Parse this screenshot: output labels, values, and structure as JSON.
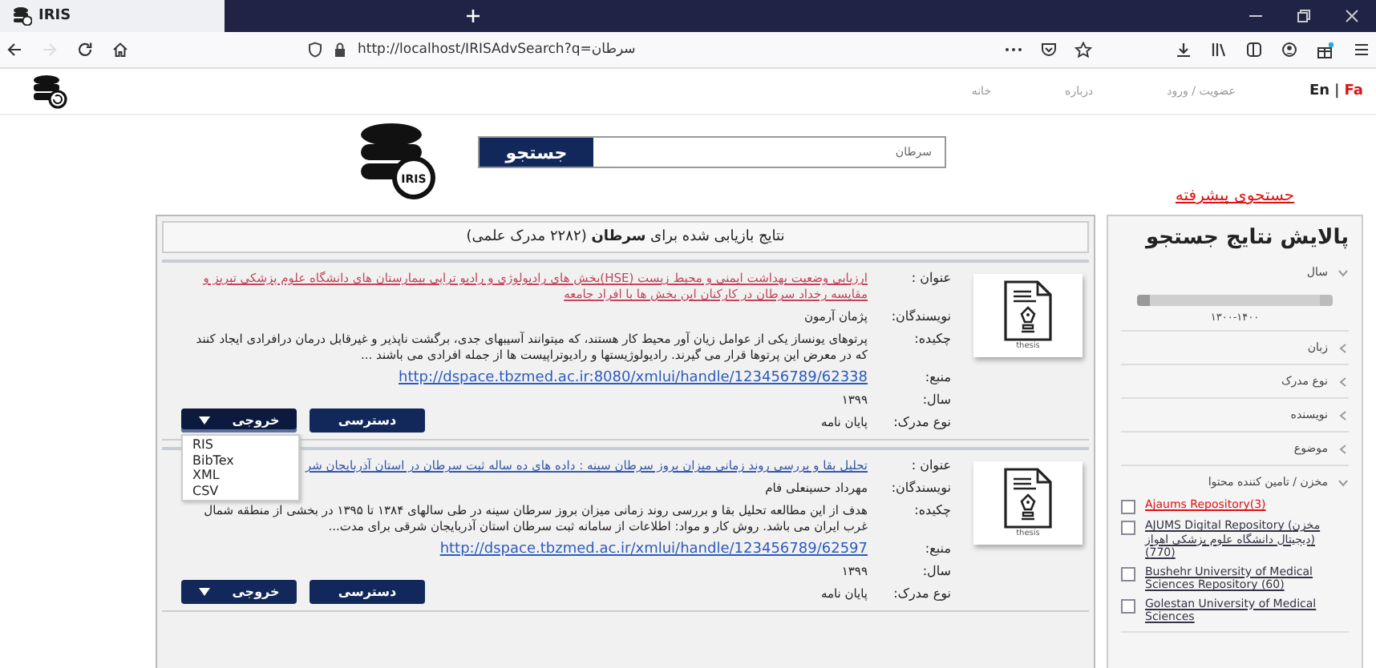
{
  "browser": {
    "tab_title": "IRIS",
    "url": "http://localhost/IRISAdvSearch?q=سرطان",
    "forward_disabled": true
  },
  "site_nav": {
    "languages": [
      {
        "label": "Fa",
        "selected": true
      },
      {
        "label": "En",
        "selected": false
      }
    ],
    "separator": "|",
    "links": [
      "عضویت / ورود",
      "درباره",
      "خانه"
    ]
  },
  "search": {
    "logo_text": "IRIS",
    "value": "سرطان",
    "button": "جستجو",
    "advanced_link": "جستجوی پیشرفته"
  },
  "results": {
    "heading": "نتایج بازیابی شده برای **سرطان** (۲۲۸۲ مدرک علمی)",
    "export_options": [
      "RIS",
      "BibTex",
      "XML",
      "CSV"
    ],
    "items": [
      {
        "thumbnail_caption": "thesis",
        "export_expanded": true,
        "buttons": [
          "دسترسی",
          "خروجی"
        ],
        "fields": [
          {
            "kind": "title",
            "label": "عنوان :",
            "value": "ارزیابی وضعیت بهداشت ایمنی و محیط زیست (HSE)بخش های رادیولوژی و رادیو تراپی بیمارستان های دانشگاه علوم پزشکی تبریز و مقایسه رخداد سرطان در کارکنان این بخش ها با افراد جامعه",
            "visited": true
          },
          {
            "kind": "text",
            "label": "نویسندگان:",
            "value": "پژمان آرمون"
          },
          {
            "kind": "text",
            "label": "چکیده:",
            "value": "پرتوهای یونساز یکی از عوامل زیان آور محیط کار هستند، که میتوانند آسیبهای جدی، برگشت ناپذیر و غیرقابل درمان درافرادی ایجاد کنند که در معرض این پرتوها قرار می گیرند. رادیولوژیستها و رادیوتراپیست ها از جمله افرادی می باشند ..."
          },
          {
            "kind": "link",
            "label": "منبع:",
            "value": "http://dspace.tbzmed.ac.ir:8080/xmlui/handle/123456789/62338"
          },
          {
            "kind": "text",
            "label": "سال:",
            "value": "۱۳۹۹"
          },
          {
            "kind": "text",
            "label": "نوع مدرک:",
            "value": "پایان نامه"
          }
        ]
      },
      {
        "thumbnail_caption": "thesis",
        "export_expanded": false,
        "buttons": [
          "دسترسی",
          "خروجی"
        ],
        "fields": [
          {
            "kind": "title",
            "label": "عنوان :",
            "value": "تحلیل بقا و بررسی روند زمانی میزان بروز سرطان سینه : داده های ده ساله ثبت سرطان در استان آذربایجان شر",
            "visited": false
          },
          {
            "kind": "text",
            "label": "نویسندگان:",
            "value": "مهرداد حسینعلی فام"
          },
          {
            "kind": "text",
            "label": "چکیده:",
            "value": "هدف از این مطالعه تحلیل بقا و بررسی روند زمانی میزان بروز سرطان سینه در طی سالهای ۱۳۸۴ تا ۱۳۹۵ در بخشی از منطقه شمال غرب ایران می باشد. روش کار و مواد: اطلاعات از سامانه ثبت سرطان استان آذربایجان شرقی برای مدت..."
          },
          {
            "kind": "link",
            "label": "منبع:",
            "value": "http://dspace.tbzmed.ac.ir/xmlui/handle/123456789/62597"
          },
          {
            "kind": "text",
            "label": "سال:",
            "value": "۱۳۹۹"
          },
          {
            "kind": "text",
            "label": "نوع مدرک:",
            "value": "پایان نامه"
          }
        ]
      }
    ]
  },
  "sidebar": {
    "title": "پالایش نتایج جستجو",
    "facets": [
      {
        "kind": "range",
        "label": "سال",
        "expanded": true,
        "level": 1,
        "reading": "۱۳۰۰-۱۴۰۰"
      },
      {
        "label": "زبان",
        "expanded": false
      },
      {
        "label": "نوع مدرک",
        "expanded": false
      },
      {
        "label": "نویسنده",
        "expanded": false
      },
      {
        "label": "موضوع",
        "expanded": false
      },
      {
        "kind": "list",
        "label": "مخزن / تامین کننده محتوا",
        "expanded": true,
        "options": [
          {
            "label": "Ajaums Repository(3)",
            "checked": false,
            "highlighted": true
          },
          {
            "label": "AJUMS Digital Repository (مخزن دیجیتال دانشگاه علوم پزشکی اهواز) (770)",
            "checked": false,
            "highlighted": false
          },
          {
            "label": "Bushehr University of Medical Sciences Repository (60)",
            "checked": false,
            "highlighted": false
          },
          {
            "label": "Golestan University of Medical Sciences",
            "checked": false,
            "highlighted": false
          }
        ]
      }
    ]
  }
}
